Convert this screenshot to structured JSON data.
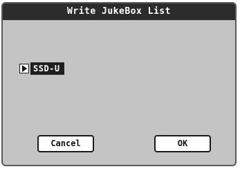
{
  "dialog": {
    "title": "Write JukeBox List"
  },
  "device": {
    "icon": "triangle-right-icon",
    "value": "SSD-U"
  },
  "buttons": {
    "cancel_label": "Cancel",
    "ok_label": "OK"
  },
  "colors": {
    "titlebar": "#2c2c2c",
    "dialog_background": "#c4c4c4",
    "selected_field": "#1f1f1f"
  }
}
